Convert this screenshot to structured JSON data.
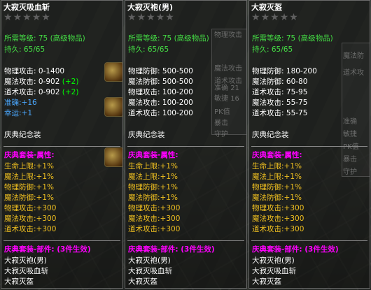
{
  "items": [
    {
      "name": "大寂灭吸血斩",
      "stars": 5,
      "level_req": "所需等级: 75 (高级物品)",
      "durability": "持久: 65/65",
      "stats": [
        {
          "label": "物理攻击:",
          "value": "0-1400",
          "bonus": ""
        },
        {
          "label": "魔法攻击:",
          "value": "0-902",
          "bonus": "(+2)"
        },
        {
          "label": "道术攻击:",
          "value": "0-902",
          "bonus": "(+2)"
        }
      ],
      "extra": [
        {
          "label": "准确:",
          "value": "+16"
        },
        {
          "label": "幸运:",
          "value": "+1"
        }
      ],
      "collection": "庆典纪念装",
      "set_title": "庆典套装-属性:",
      "set_attrs": [
        "生命上限:+1%",
        "魔法上限:+1%",
        "物理防御:+1%",
        "魔法防御:+1%",
        "物理攻击:+300",
        "魔法攻击:+300",
        "道术攻击:+300"
      ],
      "set_parts_title": "庆典套装-部件: (3件生效)",
      "set_parts": [
        "大寂灭袍(男)",
        "大寂灭吸血斩",
        "大寂灭盔"
      ]
    },
    {
      "name": "大寂灭袍(男)",
      "stars": 5,
      "level_req": "所需等级: 75 (高级物品)",
      "durability": "持久: 65/65",
      "stats": [
        {
          "label": "物理防御:",
          "value": "500-500"
        },
        {
          "label": "魔法防御:",
          "value": "500-500"
        },
        {
          "label": "物理攻击:",
          "value": "100-200"
        },
        {
          "label": "魔法攻击:",
          "value": "100-200"
        },
        {
          "label": "道术攻击:",
          "value": "100-200"
        }
      ],
      "collection": "庆典纪念装",
      "set_title": "庆典套装-属性:",
      "set_attrs": [
        "生命上限:+1%",
        "魔法上限:+1%",
        "物理防御:+1%",
        "魔法防御:+1%",
        "物理攻击:+300",
        "魔法攻击:+300",
        "道术攻击:+300"
      ],
      "set_parts_title": "庆典套装-部件: (3件生效)",
      "set_parts": [
        "大寂灭袍(男)",
        "大寂灭吸血斩",
        "大寂灭盔"
      ]
    },
    {
      "name": "大寂灭盔",
      "stars": 5,
      "level_req": "所需等级: 75 (高级物品)",
      "durability": "持久: 65/65",
      "stats": [
        {
          "label": "物理防御:",
          "value": "180-200"
        },
        {
          "label": "魔法防御:",
          "value": "60-80"
        },
        {
          "label": "道术攻击:",
          "value": "75-95"
        },
        {
          "label": "魔法攻击:",
          "value": "55-75"
        },
        {
          "label": "道术攻击:",
          "value": "55-75"
        }
      ],
      "collection": "庆典纪念装",
      "set_title": "庆典套装-属性:",
      "set_attrs": [
        "生命上限:+1%",
        "魔法上限:+1%",
        "物理防御:+1%",
        "魔法防御:+1%",
        "物理攻击:+300",
        "魔法攻击:+300",
        "道术攻击:+300"
      ],
      "set_parts_title": "庆典套装-部件: (3件生效)",
      "set_parts": [
        "大寂灭袍(男)",
        "大寂灭吸血斩",
        "大寂灭盔"
      ]
    }
  ],
  "background_hud": {
    "p2_labels": [
      "物理攻击",
      "魔法攻击",
      "道术攻击",
      "准确",
      "敏捷",
      "PK值",
      "暴击",
      "守护"
    ],
    "p2_values": [
      "21",
      "16"
    ],
    "p3_labels": [
      "魔法防",
      "道术攻",
      "准确",
      "敏捷",
      "PK值",
      "暴击",
      "守护"
    ]
  },
  "colors": {
    "green": "#00ff00",
    "pink": "#ff00ff",
    "yellow": "#f0c020",
    "blue": "#4aa8ff",
    "star_gray": "#5f5f5f"
  }
}
